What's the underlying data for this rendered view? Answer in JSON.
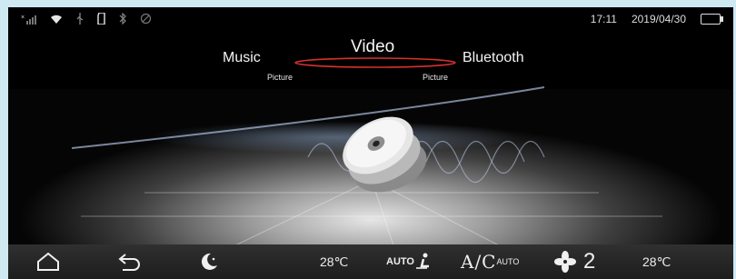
{
  "status_bar": {
    "icons": [
      "signal-icon",
      "wifi-icon",
      "usb-icon",
      "sd-card-icon",
      "bluetooth-icon",
      "gps-icon"
    ],
    "time": "17:11",
    "date": "2019/04/30",
    "battery_icon": "battery-icon"
  },
  "menu": {
    "left": "Music",
    "center": "Video",
    "right": "Bluetooth",
    "sub_left": "Picture",
    "sub_right": "Picture",
    "accent_color": "#d9302c"
  },
  "dock": {
    "icons": [
      "home-icon",
      "back-icon",
      "night-mode-icon",
      "fan-icon"
    ],
    "temp_left": "28℃",
    "auto_label": "AUTO",
    "ac_label": "A/C",
    "ac_sub": "AUTO",
    "fan_level": "2",
    "temp_right": "28℃"
  }
}
